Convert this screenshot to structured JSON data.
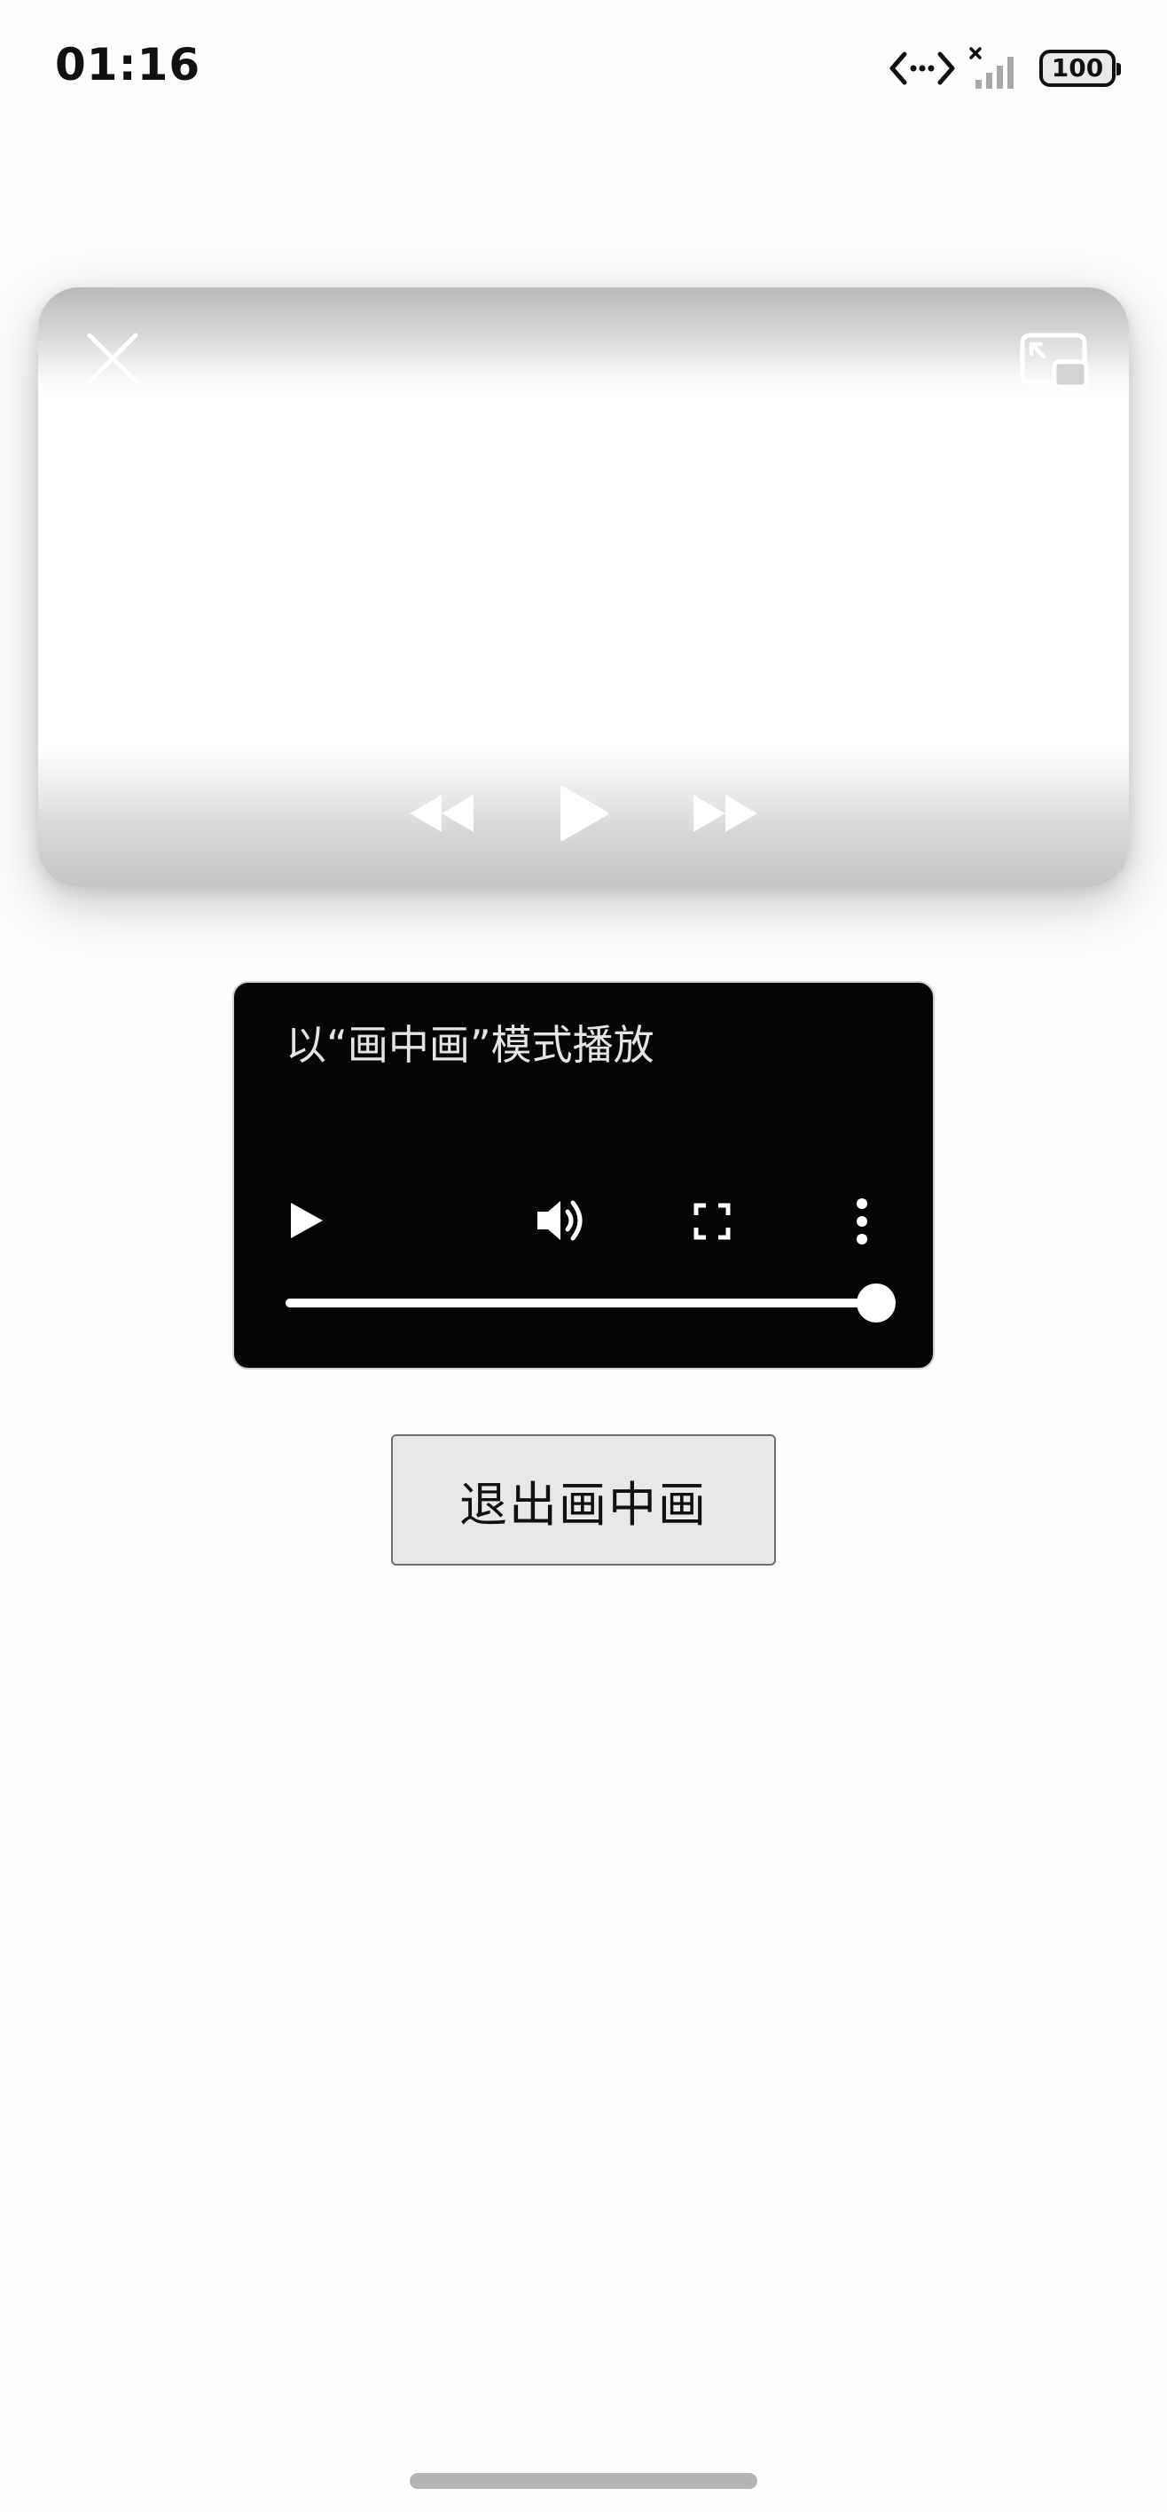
{
  "status_bar": {
    "time": "01:16",
    "battery_level": "100",
    "icons": [
      "data-transfer-icon",
      "no-sim-signal-icon",
      "battery-icon"
    ]
  },
  "pip_window": {
    "close_icon": "close-icon",
    "restore_icon": "restore-to-app-icon",
    "controls": [
      "rewind-icon",
      "play-icon",
      "fast-forward-icon"
    ]
  },
  "video": {
    "title": "以“画中画”模式播放",
    "controls": [
      "play-icon",
      "volume-icon",
      "fullscreen-icon",
      "more-options-icon"
    ],
    "progress": 1.0
  },
  "exit_button": {
    "label": "退出画中画"
  },
  "colors": {
    "background": "#fdfdfd",
    "video_background": "#050505",
    "button_background": "#e8e8e8",
    "home_indicator": "#b4b4b4"
  }
}
